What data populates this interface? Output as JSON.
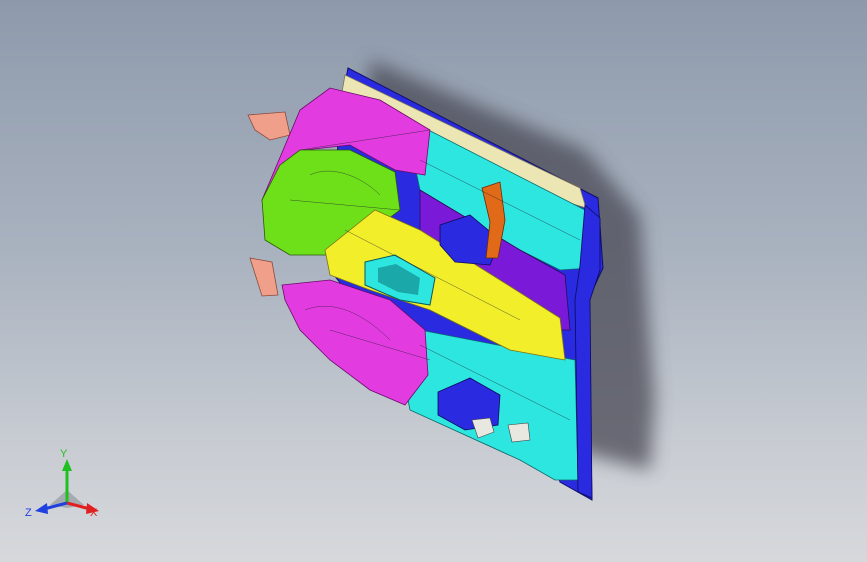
{
  "viewport": {
    "background_top": "#8e9aac",
    "background_bottom": "#d6d8dc"
  },
  "model": {
    "part_colors": {
      "magenta": "#e23ce0",
      "green": "#6ee01a",
      "yellow": "#f2ee2a",
      "cyan": "#2ee6e0",
      "blue": "#2a2ae0",
      "purple": "#7a1ad8",
      "orange": "#e06a18",
      "beige": "#ece6b4",
      "salmon": "#f0a08a",
      "shadow": "#4a4a55"
    }
  },
  "triad": {
    "x_label": "X",
    "y_label": "Y",
    "z_label": "Z",
    "x_color": "#e02020",
    "y_color": "#20c020",
    "z_color": "#2040e0"
  }
}
